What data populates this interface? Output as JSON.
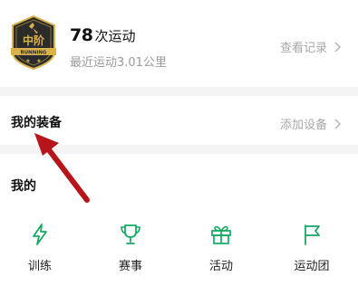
{
  "stats": {
    "count": "78",
    "count_unit": "次运动",
    "recent": "最近运动3.01公里",
    "history_link": "查看记录",
    "badge": {
      "level": "中阶",
      "ribbon": "RUNNING"
    }
  },
  "gear": {
    "title": "我的装备",
    "add_link": "添加设备"
  },
  "mine": {
    "title": "我的",
    "items": [
      {
        "label": "训练",
        "icon": "lightning-icon"
      },
      {
        "label": "赛事",
        "icon": "trophy-icon"
      },
      {
        "label": "活动",
        "icon": "gift-icon"
      },
      {
        "label": "运动团",
        "icon": "flag-icon"
      }
    ]
  },
  "colors": {
    "accent": "#16a864",
    "annotation_arrow": "#b5151b",
    "badge_dark": "#2b2b2b",
    "badge_gold": "#d9b24c"
  }
}
